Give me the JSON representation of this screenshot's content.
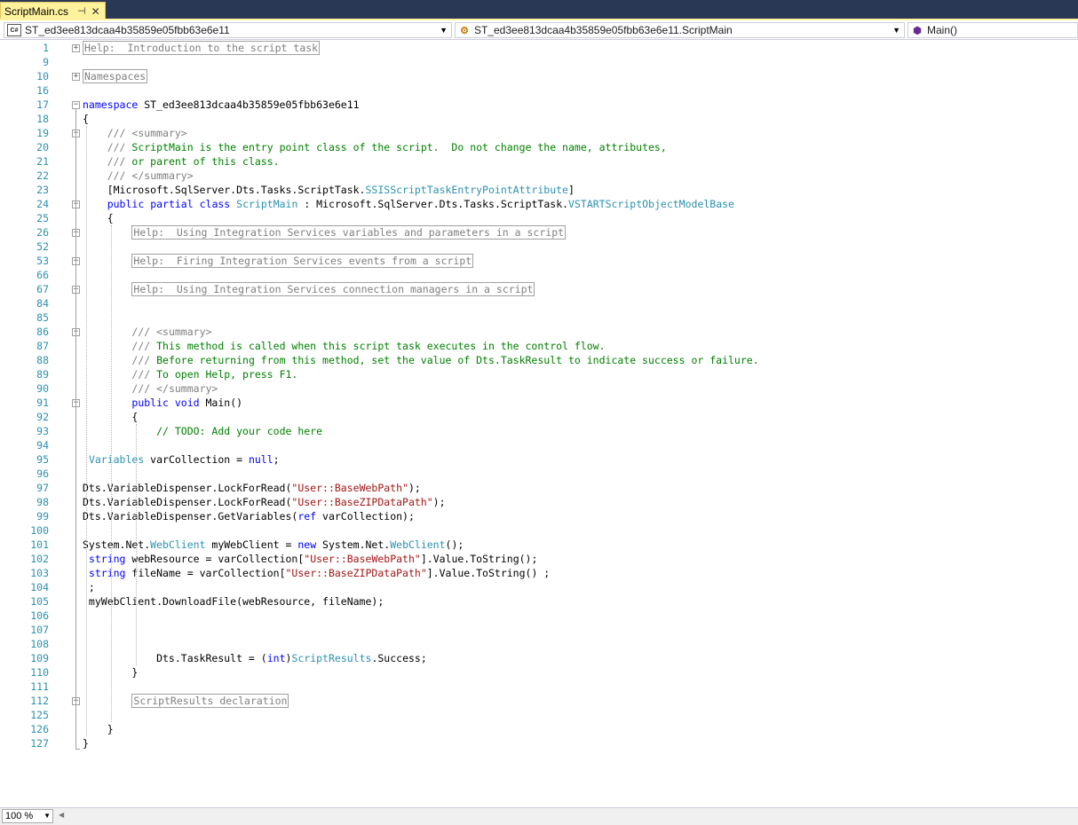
{
  "tab": {
    "title": "ScriptMain.cs",
    "pin_icon": "pin-icon",
    "close_icon": "close-icon"
  },
  "navbar": {
    "project": "ST_ed3ee813dcaa4b35859e05fbb63e6e11",
    "class": "ST_ed3ee813dcaa4b35859e05fbb63e6e11.ScriptMain",
    "member": "Main()"
  },
  "lines": [
    {
      "n": "1",
      "html": "<span class=\"box\">Help:  Introduction to the script task</span>"
    },
    {
      "n": "9",
      "html": ""
    },
    {
      "n": "10",
      "html": "<span class=\"box\">Namespaces</span>"
    },
    {
      "n": "16",
      "html": ""
    },
    {
      "n": "17",
      "html": "<span class=\"k\">namespace</span> ST_ed3ee813dcaa4b35859e05fbb63e6e11"
    },
    {
      "n": "18",
      "html": "{"
    },
    {
      "n": "19",
      "html": "    <span class=\"g\">///</span> <span class=\"g\">&lt;summary&gt;</span>"
    },
    {
      "n": "20",
      "html": "    <span class=\"g\">///</span><span class=\"c\"> ScriptMain is the entry point class of the script.  Do not change the name, attributes,</span>"
    },
    {
      "n": "21",
      "html": "    <span class=\"g\">///</span><span class=\"c\"> or parent of this class.</span>"
    },
    {
      "n": "22",
      "html": "    <span class=\"g\">///</span> <span class=\"g\">&lt;/summary&gt;</span>"
    },
    {
      "n": "23",
      "html": "    [Microsoft.SqlServer.Dts.Tasks.ScriptTask.<span class=\"t\">SSISScriptTaskEntryPointAttribute</span>]"
    },
    {
      "n": "24",
      "html": "    <span class=\"k\">public</span> <span class=\"k\">partial</span> <span class=\"k\">class</span> <span class=\"t\">ScriptMain</span> : Microsoft.SqlServer.Dts.Tasks.ScriptTask.<span class=\"t\">VSTARTScriptObjectModelBase</span>"
    },
    {
      "n": "25",
      "html": "    {"
    },
    {
      "n": "26",
      "html": "        <span class=\"box\">Help:  Using Integration Services variables and parameters in a script</span>"
    },
    {
      "n": "52",
      "html": ""
    },
    {
      "n": "53",
      "html": "        <span class=\"box\">Help:  Firing Integration Services events from a script</span>"
    },
    {
      "n": "66",
      "html": ""
    },
    {
      "n": "67",
      "html": "        <span class=\"box\">Help:  Using Integration Services connection managers in a script</span>"
    },
    {
      "n": "84",
      "html": ""
    },
    {
      "n": "85",
      "html": ""
    },
    {
      "n": "86",
      "html": "        <span class=\"g\">///</span> <span class=\"g\">&lt;summary&gt;</span>"
    },
    {
      "n": "87",
      "html": "        <span class=\"g\">///</span><span class=\"c\"> This method is called when this script task executes in the control flow.</span>"
    },
    {
      "n": "88",
      "html": "        <span class=\"g\">///</span><span class=\"c\"> Before returning from this method, set the value of Dts.TaskResult to indicate success or failure.</span>"
    },
    {
      "n": "89",
      "html": "        <span class=\"g\">///</span><span class=\"c\"> To open Help, press F1.</span>"
    },
    {
      "n": "90",
      "html": "        <span class=\"g\">///</span> <span class=\"g\">&lt;/summary&gt;</span>"
    },
    {
      "n": "91",
      "html": "        <span class=\"k\">public</span> <span class=\"k\">void</span> Main()"
    },
    {
      "n": "92",
      "html": "        {"
    },
    {
      "n": "93",
      "html": "            <span class=\"c\">// TODO: Add your code here</span>"
    },
    {
      "n": "94",
      "html": ""
    },
    {
      "n": "95",
      "html": " <span class=\"t\">Variables</span> varCollection = <span class=\"k\">null</span>;"
    },
    {
      "n": "96",
      "html": ""
    },
    {
      "n": "97",
      "html": "Dts.VariableDispenser.LockForRead(<span class=\"s\">\"User::BaseWebPath\"</span>);"
    },
    {
      "n": "98",
      "html": "Dts.VariableDispenser.LockForRead(<span class=\"s\">\"User::BaseZIPDataPath\"</span>);"
    },
    {
      "n": "99",
      "html": "Dts.VariableDispenser.GetVariables(<span class=\"k\">ref</span> varCollection);"
    },
    {
      "n": "100",
      "html": ""
    },
    {
      "n": "101",
      "html": "System.Net.<span class=\"t\">WebClient</span> myWebClient = <span class=\"k\">new</span> System.Net.<span class=\"t\">WebClient</span>();"
    },
    {
      "n": "102",
      "html": " <span class=\"k\">string</span> webResource = varCollection[<span class=\"s\">\"User::BaseWebPath\"</span>].Value.ToString();"
    },
    {
      "n": "103",
      "html": " <span class=\"k\">string</span> fileName = varCollection[<span class=\"s\">\"User::BaseZIPDataPath\"</span>].Value.ToString() ;"
    },
    {
      "n": "104",
      "html": " ;"
    },
    {
      "n": "105",
      "html": " myWebClient.DownloadFile(webResource, fileName);"
    },
    {
      "n": "106",
      "html": ""
    },
    {
      "n": "107",
      "html": ""
    },
    {
      "n": "108",
      "html": ""
    },
    {
      "n": "109",
      "html": "            Dts.TaskResult = (<span class=\"k\">int</span>)<span class=\"t\">ScriptResults</span>.Success;"
    },
    {
      "n": "110",
      "html": "        }"
    },
    {
      "n": "111",
      "html": ""
    },
    {
      "n": "112",
      "html": "        <span class=\"box\">ScriptResults declaration</span>"
    },
    {
      "n": "125",
      "html": ""
    },
    {
      "n": "126",
      "html": "    }"
    },
    {
      "n": "127",
      "html": "}"
    }
  ],
  "outline_markers": [
    {
      "line": "1",
      "sym": "+"
    },
    {
      "line": "10",
      "sym": "+"
    },
    {
      "line": "17",
      "sym": "−"
    },
    {
      "line": "19",
      "sym": "−"
    },
    {
      "line": "24",
      "sym": "−"
    },
    {
      "line": "26",
      "sym": "+"
    },
    {
      "line": "53",
      "sym": "+"
    },
    {
      "line": "67",
      "sym": "+"
    },
    {
      "line": "86",
      "sym": "−"
    },
    {
      "line": "91",
      "sym": "−"
    },
    {
      "line": "112",
      "sym": "+"
    }
  ],
  "statusbar": {
    "zoom": "100 %"
  }
}
